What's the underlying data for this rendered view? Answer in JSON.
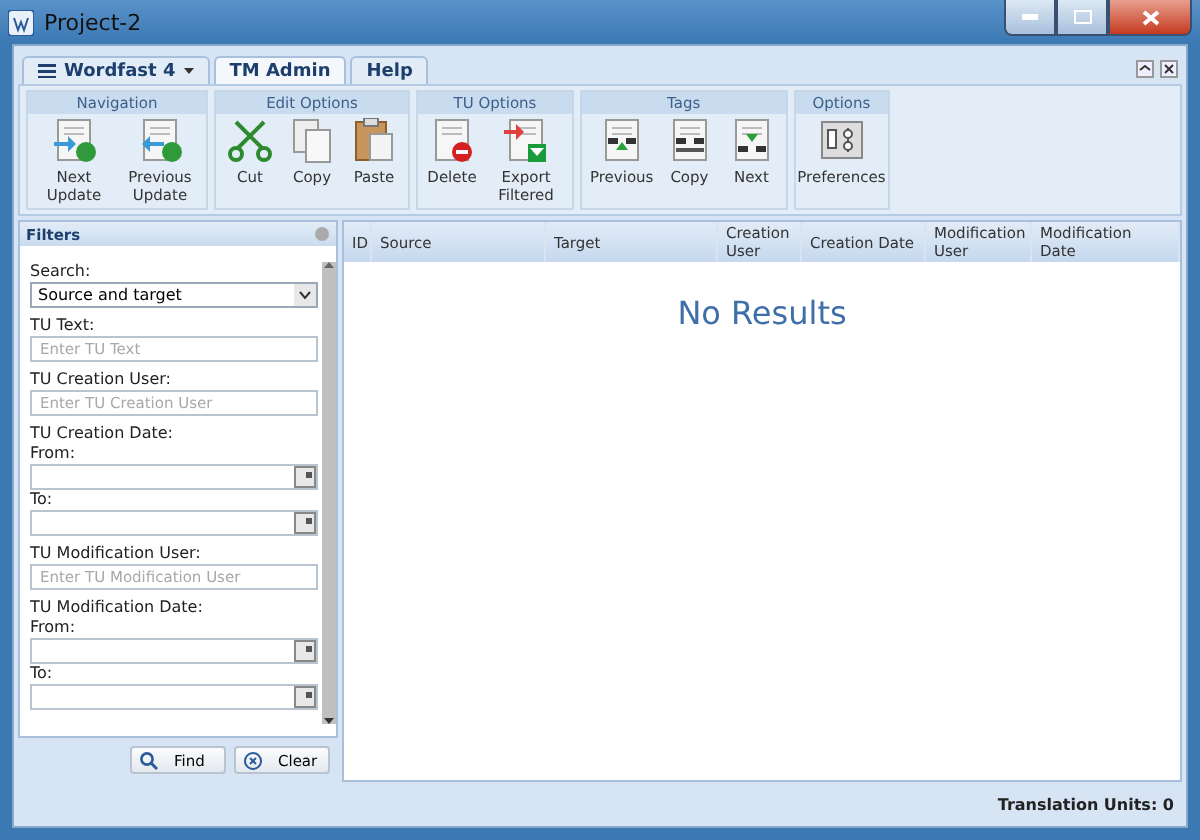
{
  "window": {
    "title": "Project-2"
  },
  "tabs": [
    {
      "label": "Wordfast 4",
      "kind": "menu",
      "selected": false
    },
    {
      "label": "TM Admin",
      "kind": "tab",
      "selected": true
    },
    {
      "label": "Help",
      "kind": "tab",
      "selected": false
    }
  ],
  "ribbon": [
    {
      "title": "Navigation",
      "buttons": [
        {
          "label": "Next Update",
          "kind": "forward"
        },
        {
          "label": "Previous Update",
          "kind": "back"
        }
      ]
    },
    {
      "title": "Edit Options",
      "buttons": [
        {
          "label": "Cut",
          "kind": "scissors"
        },
        {
          "label": "Copy",
          "kind": "copy"
        },
        {
          "label": "Paste",
          "kind": "paste"
        }
      ]
    },
    {
      "title": "TU Options",
      "buttons": [
        {
          "label": "Delete",
          "kind": "delete"
        },
        {
          "label": "Export Filtered",
          "kind": "export"
        }
      ]
    },
    {
      "title": "Tags",
      "buttons": [
        {
          "label": "Previous",
          "kind": "previous"
        },
        {
          "label": "Copy",
          "kind": "swap"
        },
        {
          "label": "Next",
          "kind": "next"
        }
      ]
    },
    {
      "title": "Options",
      "buttons": [
        {
          "label": "Preferences",
          "kind": "settings"
        }
      ]
    }
  ],
  "filters": {
    "title": "Filters",
    "fields": [
      {
        "kind": "select",
        "label": "Search:",
        "value": "Source and target"
      },
      {
        "kind": "text",
        "label": "TU Text:",
        "placeholder": "Enter TU Text"
      },
      {
        "kind": "text",
        "label": "TU Creation User:",
        "placeholder": "Enter TU Creation User"
      },
      {
        "kind": "heading",
        "label": "TU Creation Date:"
      },
      {
        "kind": "date",
        "label": "From:"
      },
      {
        "kind": "date",
        "label": "To:"
      },
      {
        "kind": "text",
        "label": "TU Modification User:",
        "placeholder": "Enter TU Modification User"
      },
      {
        "kind": "heading",
        "label": "TU Modification Date:"
      },
      {
        "kind": "date",
        "label": "From:"
      },
      {
        "kind": "date",
        "label": "To:"
      }
    ],
    "buttons": [
      {
        "label": "Find",
        "kind": "search"
      },
      {
        "label": "Clear",
        "kind": "clear"
      }
    ]
  },
  "table": {
    "columns": [
      "ID",
      "Source",
      "Target",
      "Creation User",
      "Creation Date",
      "Modification User",
      "Modification Date"
    ],
    "empty_message": "No Results"
  },
  "status_bar": "Translation Units: 0"
}
